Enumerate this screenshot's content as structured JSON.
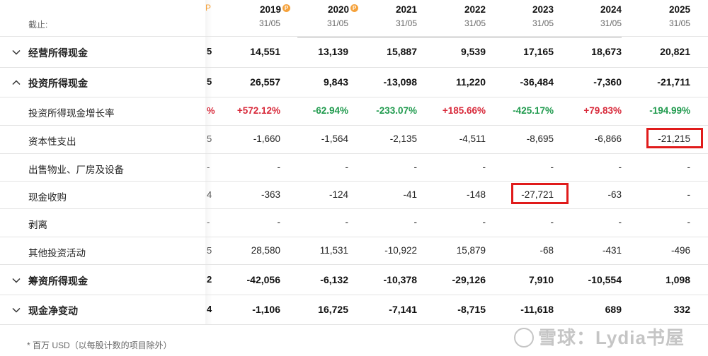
{
  "header": {
    "period_label": "截止:",
    "years": [
      {
        "year": "2019",
        "date": "31/05",
        "badge": "P"
      },
      {
        "year": "2020",
        "date": "31/05",
        "badge": "P"
      },
      {
        "year": "2021",
        "date": "31/05",
        "badge": ""
      },
      {
        "year": "2022",
        "date": "31/05",
        "badge": ""
      },
      {
        "year": "2023",
        "date": "31/05",
        "badge": ""
      },
      {
        "year": "2024",
        "date": "31/05",
        "badge": ""
      },
      {
        "year": "2025",
        "date": "31/05",
        "badge": ""
      }
    ]
  },
  "rows": [
    {
      "label": "经营所得现金",
      "bold": true,
      "chevron": "down",
      "cut": "5",
      "values": [
        "14,551",
        "13,139",
        "15,887",
        "9,539",
        "17,165",
        "18,673",
        "20,821"
      ]
    },
    {
      "label": "投资所得现金",
      "bold": true,
      "chevron": "up",
      "cut": "5",
      "values": [
        "26,557",
        "9,843",
        "-13,098",
        "11,220",
        "-36,484",
        "-7,360",
        "-21,711"
      ]
    },
    {
      "label": "投资所得现金增长率",
      "bold": false,
      "chevron": "",
      "cut": "%",
      "growth": true,
      "values": [
        "+572.12%",
        "-62.94%",
        "-233.07%",
        "+185.66%",
        "-425.17%",
        "+79.83%",
        "-194.99%"
      ]
    },
    {
      "label": "资本性支出",
      "bold": false,
      "chevron": "",
      "cut": "5",
      "values": [
        "-1,660",
        "-1,564",
        "-2,135",
        "-4,511",
        "-8,695",
        "-6,866",
        "-21,215"
      ]
    },
    {
      "label": "出售物业、厂房及设备",
      "bold": false,
      "chevron": "",
      "cut": "-",
      "values": [
        "-",
        "-",
        "-",
        "-",
        "-",
        "-",
        "-"
      ]
    },
    {
      "label": "现金收购",
      "bold": false,
      "chevron": "",
      "cut": "4",
      "values": [
        "-363",
        "-124",
        "-41",
        "-148",
        "-27,721",
        "-63",
        "-"
      ]
    },
    {
      "label": "剥离",
      "bold": false,
      "chevron": "",
      "cut": "-",
      "values": [
        "-",
        "-",
        "-",
        "-",
        "-",
        "-",
        "-"
      ]
    },
    {
      "label": "其他投资活动",
      "bold": false,
      "chevron": "",
      "cut": "5",
      "values": [
        "28,580",
        "11,531",
        "-10,922",
        "15,879",
        "-68",
        "-431",
        "-496"
      ]
    },
    {
      "label": "筹资所得现金",
      "bold": true,
      "chevron": "down",
      "cut": "2",
      "values": [
        "-42,056",
        "-6,132",
        "-10,378",
        "-29,126",
        "7,910",
        "-10,554",
        "1,098"
      ]
    },
    {
      "label": "现金净变动",
      "bold": true,
      "chevron": "down",
      "cut": "4",
      "values": [
        "-1,106",
        "16,725",
        "-7,141",
        "-8,715",
        "-11,618",
        "689",
        "332"
      ]
    }
  ],
  "footnote": "* 百万 USD（以每股计数的项目除外）",
  "watermark": "雪球：Lydia书屋",
  "colors": {
    "positive": "#d8293a",
    "negative": "#1f9a4d",
    "highlight": "#e01b1b",
    "badge": "#f5a23c"
  }
}
